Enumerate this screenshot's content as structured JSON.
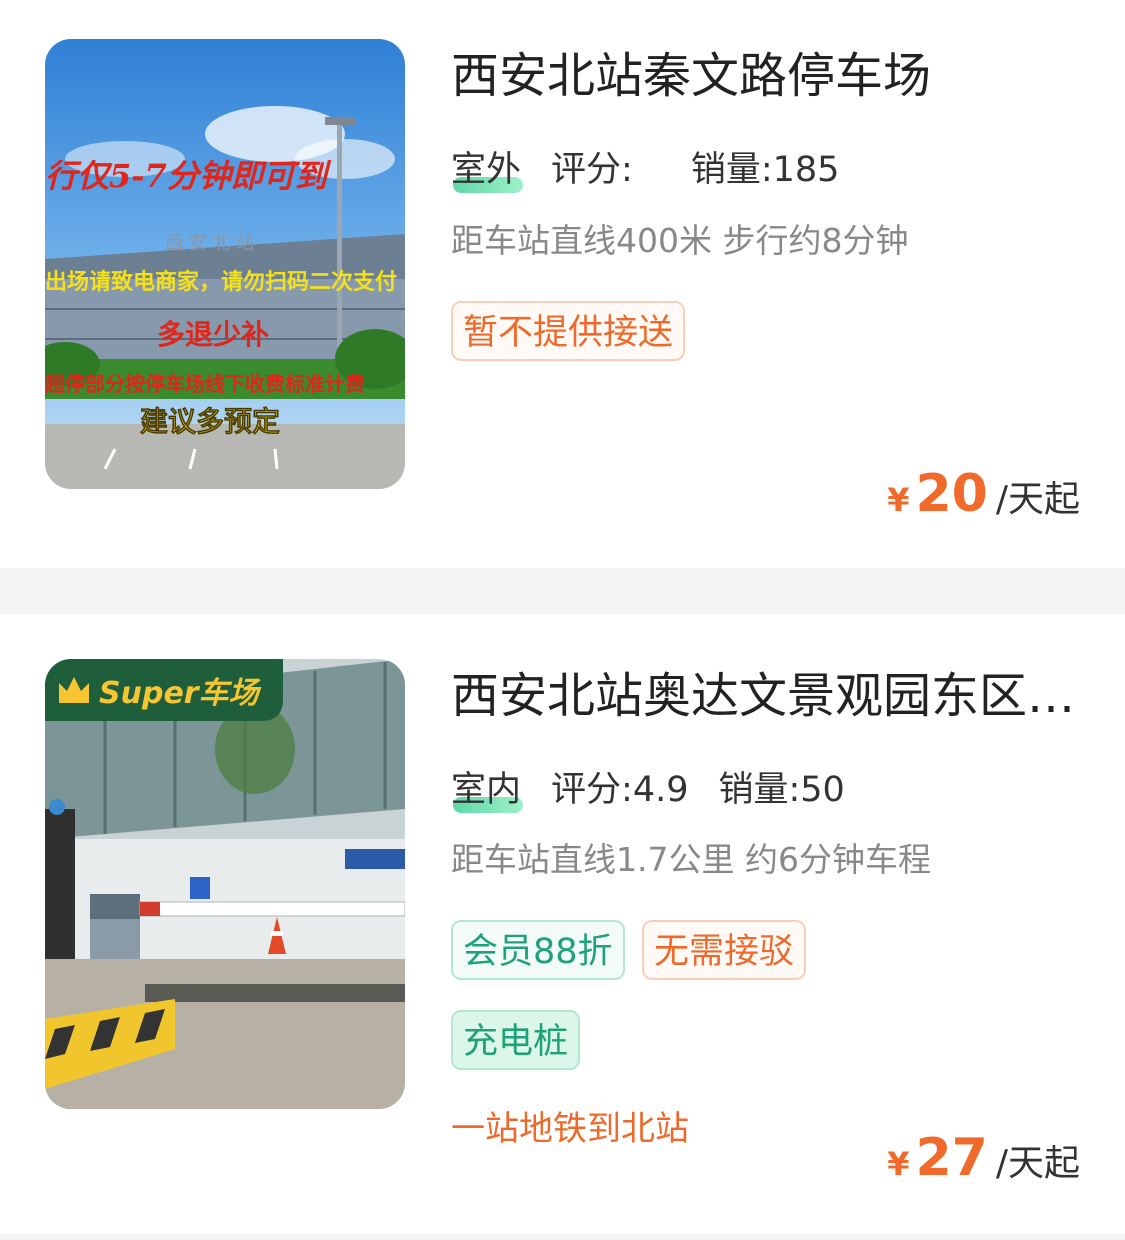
{
  "listings": [
    {
      "title": "西安北站秦文路停车场",
      "type": "室外",
      "rating_label": "评分:",
      "rating_value": "",
      "sales_label": "销量:",
      "sales_value": "185",
      "distance": "距车站直线400米 步行约8分钟",
      "tags": [
        "暂不提供接送"
      ],
      "price_currency": "¥",
      "price_value": "20",
      "price_unit": "/天起",
      "image_text": {
        "line1": "行仅5-7分钟即可到",
        "line2": "出场请致电商家，请勿扫码二次支付",
        "line3": "多退少补",
        "line4": "超停部分按停车场线下收费标准计费",
        "line5": "建议多预定",
        "station_sign": "西 安 北 站"
      }
    },
    {
      "title": "西安北站奥达文景观园东区…",
      "type": "室内",
      "rating_label": "评分:",
      "rating_value": "4.9",
      "sales_label": "销量:",
      "sales_value": "50",
      "distance": "距车站直线1.7公里 约6分钟车程",
      "tags": [
        "会员88折",
        "无需接驳",
        "充电桩"
      ],
      "promo": "一站地铁到北站",
      "badge": "Super车场",
      "price_currency": "¥",
      "price_value": "27",
      "price_unit": "/天起"
    }
  ],
  "colors": {
    "accent": "#f06b2b",
    "green_tag": "#1ea27a",
    "divider": "#f4f4f4"
  }
}
